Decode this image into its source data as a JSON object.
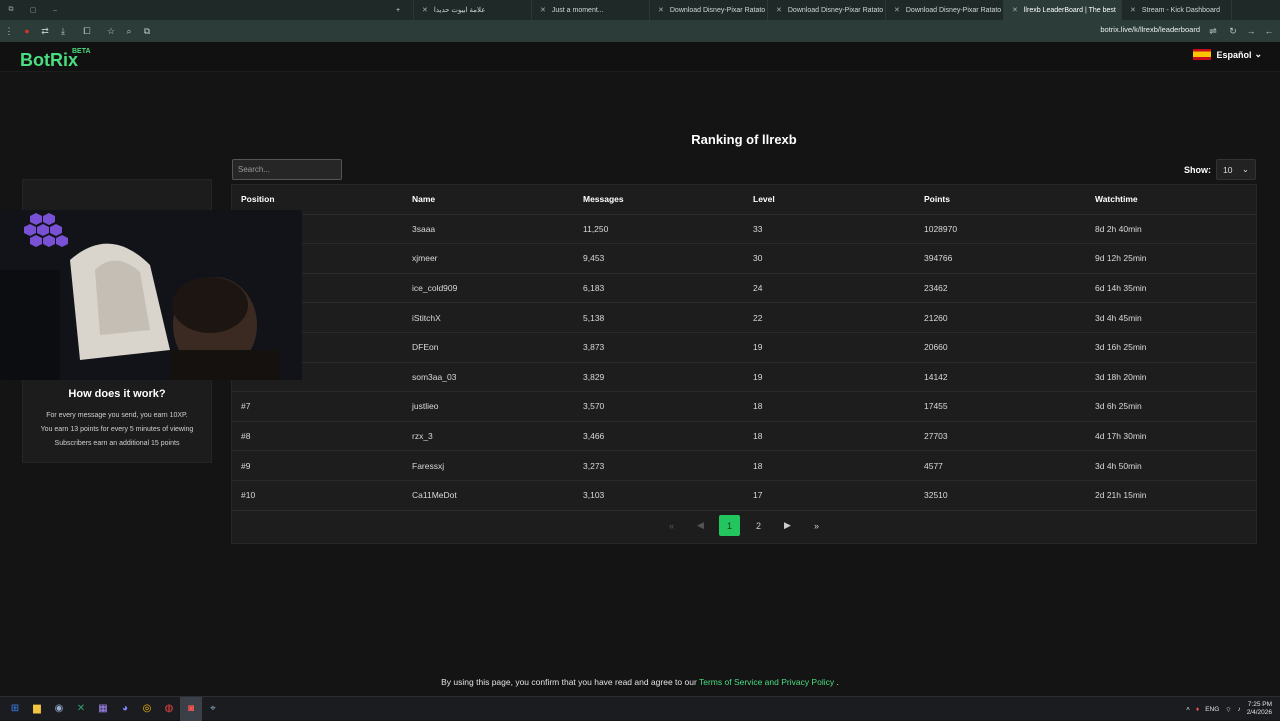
{
  "browser": {
    "tabs": [
      {
        "title": "علامة ابيوت حديدا",
        "active": false
      },
      {
        "title": "Just a moment...",
        "active": false
      },
      {
        "title": "Download Disney-Pixar Ratato",
        "active": false
      },
      {
        "title": "Download Disney-Pixar Ratato",
        "active": false
      },
      {
        "title": "Download Disney-Pixar Ratato",
        "active": false
      },
      {
        "title": "llrexb LeaderBoard | The best",
        "active": true
      },
      {
        "title": "Stream - Kick Dashboard",
        "active": false
      }
    ],
    "new_tab_icon": "+",
    "url": "botrix.live/k/llrexb/leaderboard"
  },
  "header": {
    "logo": "BotRix",
    "beta": "BETA",
    "language": "Español"
  },
  "page": {
    "title": "Ranking of llrexb",
    "search_placeholder": "Search...",
    "show_label": "Show:",
    "show_value": "10"
  },
  "table": {
    "headers": [
      "Position",
      "Name",
      "Messages",
      "Level",
      "Points",
      "Watchtime"
    ],
    "rows": [
      {
        "position": "",
        "name": "3saaa",
        "messages": "11,250",
        "level": "33",
        "points": "1028970",
        "watchtime": "8d 2h 40min"
      },
      {
        "position": "",
        "name": "xjmeer",
        "messages": "9,453",
        "level": "30",
        "points": "394766",
        "watchtime": "9d 12h 25min"
      },
      {
        "position": "",
        "name": "ice_cold909",
        "messages": "6,183",
        "level": "24",
        "points": "23462",
        "watchtime": "6d 14h 35min"
      },
      {
        "position": "",
        "name": "iStitchX",
        "messages": "5,138",
        "level": "22",
        "points": "21260",
        "watchtime": "3d 4h 45min"
      },
      {
        "position": "",
        "name": "DFEon",
        "messages": "3,873",
        "level": "19",
        "points": "20660",
        "watchtime": "3d 16h 25min"
      },
      {
        "position": "",
        "name": "som3aa_03",
        "messages": "3,829",
        "level": "19",
        "points": "14142",
        "watchtime": "3d 18h 20min"
      },
      {
        "position": "#7",
        "name": "justlieo",
        "messages": "3,570",
        "level": "18",
        "points": "17455",
        "watchtime": "3d 6h 25min"
      },
      {
        "position": "#8",
        "name": "rzx_3",
        "messages": "3,466",
        "level": "18",
        "points": "27703",
        "watchtime": "4d 17h 30min"
      },
      {
        "position": "#9",
        "name": "Faressxj",
        "messages": "3,273",
        "level": "18",
        "points": "4577",
        "watchtime": "3d 4h 50min"
      },
      {
        "position": "#10",
        "name": "Ca11MeDot",
        "messages": "3,103",
        "level": "17",
        "points": "32510",
        "watchtime": "2d 21h 15min"
      }
    ]
  },
  "pagination": {
    "current": "1",
    "next_page": "2"
  },
  "info_card": {
    "title": "How does it work?",
    "lines": [
      "For every message you send, you earn 10XP.",
      "You earn 13 points for every 5 minutes of viewing",
      "Subscribers earn an additional 15 points"
    ]
  },
  "footer": {
    "text": "By using this page, you confirm that you have read and agree to our",
    "link": "Terms of Service and Privacy Policy",
    "end": "."
  },
  "taskbar": {
    "lang": "ENG",
    "time": "7:25 PM",
    "date": "2/4/2026"
  },
  "colors": {
    "accent": "#4ade80",
    "page_bg": "#141414",
    "card_bg": "#1d1d1d",
    "active_page": "#22c55e"
  }
}
